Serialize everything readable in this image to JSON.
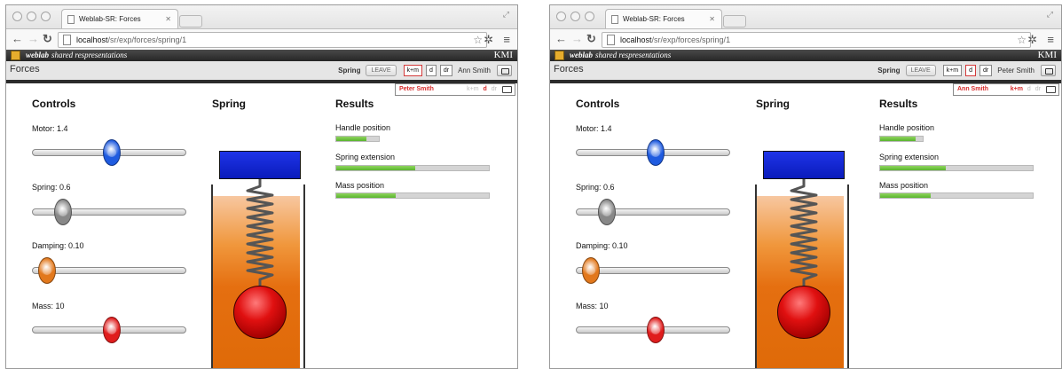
{
  "windows": [
    {
      "browser": {
        "tab_title": "Weblab-SR: Forces",
        "url_host": "localhost",
        "url_path": "/sr/exp/forces/spring/1"
      },
      "header": {
        "brand_bold": "weblab",
        "brand_rest": "shared respresentations",
        "org_logo": "KMI",
        "app_title": "Forces",
        "session_label": "Spring",
        "leave_label": "LEAVE",
        "modes": [
          "k+m",
          "d",
          "dr"
        ],
        "active_mode": "k+m",
        "user_name": "Ann Smith"
      },
      "peer": {
        "name": "Peter Smith",
        "modes": [
          "k+m",
          "d",
          "dr"
        ],
        "active_mode": "d"
      },
      "controls": {
        "heading": "Controls",
        "sliders": [
          {
            "label": "Motor: 1.4",
            "value": 1.4,
            "fraction": 0.52,
            "color": "#1f5be0"
          },
          {
            "label": "Spring: 0.6",
            "value": 0.6,
            "fraction": 0.2,
            "color": "#888888"
          },
          {
            "label": "Damping: 0.10",
            "value": 0.1,
            "fraction": 0.1,
            "color": "#e2781c"
          },
          {
            "label": "Mass: 10",
            "value": 10,
            "fraction": 0.52,
            "color": "#e01d1d"
          }
        ]
      },
      "spring": {
        "heading": "Spring"
      },
      "results": {
        "heading": "Results",
        "items": [
          {
            "label": "Handle position",
            "fraction": 0.7
          },
          {
            "label": "Spring extension",
            "fraction": 0.52
          },
          {
            "label": "Mass position",
            "fraction": 0.39
          }
        ]
      }
    },
    {
      "browser": {
        "tab_title": "Weblab-SR: Forces",
        "url_host": "localhost",
        "url_path": "/sr/exp/forces/spring/1"
      },
      "header": {
        "brand_bold": "weblab",
        "brand_rest": "shared respresentations",
        "org_logo": "KMI",
        "app_title": "Forces",
        "session_label": "Spring",
        "leave_label": "LEAVE",
        "modes": [
          "k+m",
          "d",
          "dr"
        ],
        "active_mode": "d",
        "user_name": "Peter Smith"
      },
      "peer": {
        "name": "Ann Smith",
        "modes": [
          "k+m",
          "d",
          "dr"
        ],
        "active_mode": "k+m"
      },
      "controls": {
        "heading": "Controls",
        "sliders": [
          {
            "label": "Motor: 1.4",
            "value": 1.4,
            "fraction": 0.52,
            "color": "#1f5be0"
          },
          {
            "label": "Spring: 0.6",
            "value": 0.6,
            "fraction": 0.2,
            "color": "#888888"
          },
          {
            "label": "Damping: 0.10",
            "value": 0.1,
            "fraction": 0.1,
            "color": "#e2781c"
          },
          {
            "label": "Mass: 10",
            "value": 10,
            "fraction": 0.52,
            "color": "#e01d1d"
          }
        ]
      },
      "spring": {
        "heading": "Spring"
      },
      "results": {
        "heading": "Results",
        "items": [
          {
            "label": "Handle position",
            "fraction": 0.83
          },
          {
            "label": "Spring extension",
            "fraction": 0.43
          },
          {
            "label": "Mass position",
            "fraction": 0.33
          }
        ]
      }
    }
  ]
}
